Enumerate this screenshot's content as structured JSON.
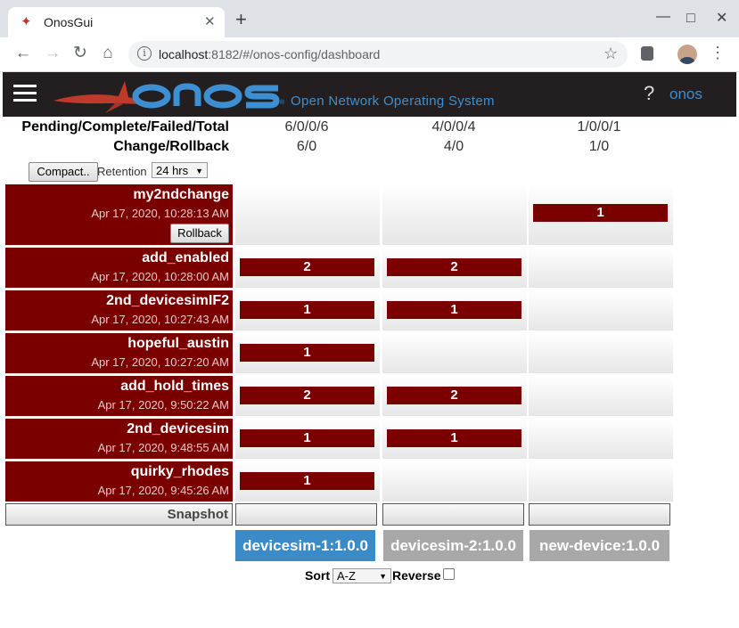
{
  "browser": {
    "tab_title": "OnosGui",
    "url_host": "localhost",
    "url_rest": ":8182/#/onos-config/dashboard"
  },
  "masthead": {
    "subtitle": "Open Network Operating System",
    "help": "?",
    "user": "onos"
  },
  "summary": {
    "header1": "Pending/Complete/Failed/Total",
    "header2": "Change/Rollback",
    "columns": [
      {
        "counts": "6/0/0/6",
        "change_rollback": "6/0"
      },
      {
        "counts": "4/0/0/4",
        "change_rollback": "4/0"
      },
      {
        "counts": "1/0/0/1",
        "change_rollback": "1/0"
      }
    ]
  },
  "controls": {
    "compact_label": "Compact..",
    "retention_label": "Retention",
    "retention_value": "24 hrs"
  },
  "changes": [
    {
      "name": "my2ndchange",
      "time": "Apr 17, 2020, 10:28:13 AM",
      "rollback": "Rollback",
      "cells": [
        "",
        "",
        "1"
      ]
    },
    {
      "name": "add_enabled",
      "time": "Apr 17, 2020, 10:28:00 AM",
      "cells": [
        "2",
        "2",
        ""
      ]
    },
    {
      "name": "2nd_devicesimIF2",
      "time": "Apr 17, 2020, 10:27:43 AM",
      "cells": [
        "1",
        "1",
        ""
      ]
    },
    {
      "name": "hopeful_austin",
      "time": "Apr 17, 2020, 10:27:20 AM",
      "cells": [
        "1",
        "",
        ""
      ]
    },
    {
      "name": "add_hold_times",
      "time": "Apr 17, 2020, 9:50:22 AM",
      "cells": [
        "2",
        "2",
        ""
      ]
    },
    {
      "name": "2nd_devicesim",
      "time": "Apr 17, 2020, 9:48:55 AM",
      "cells": [
        "1",
        "1",
        ""
      ]
    },
    {
      "name": "quirky_rhodes",
      "time": "Apr 17, 2020, 9:45:26 AM",
      "cells": [
        "1",
        "",
        ""
      ]
    }
  ],
  "snapshot_label": "Snapshot",
  "devices": [
    {
      "label": "devicesim-1:1.0.0",
      "active": true
    },
    {
      "label": "devicesim-2:1.0.0",
      "active": false
    },
    {
      "label": "new-device:1.0.0",
      "active": false
    }
  ],
  "sort": {
    "label": "Sort",
    "value": "A-Z",
    "reverse_label": "Reverse"
  },
  "colors": {
    "accent_red": "#7a0000",
    "onos_blue": "#3d8fd1",
    "active_device": "#3b8bc9",
    "inactive_device": "#a8a8a8"
  }
}
